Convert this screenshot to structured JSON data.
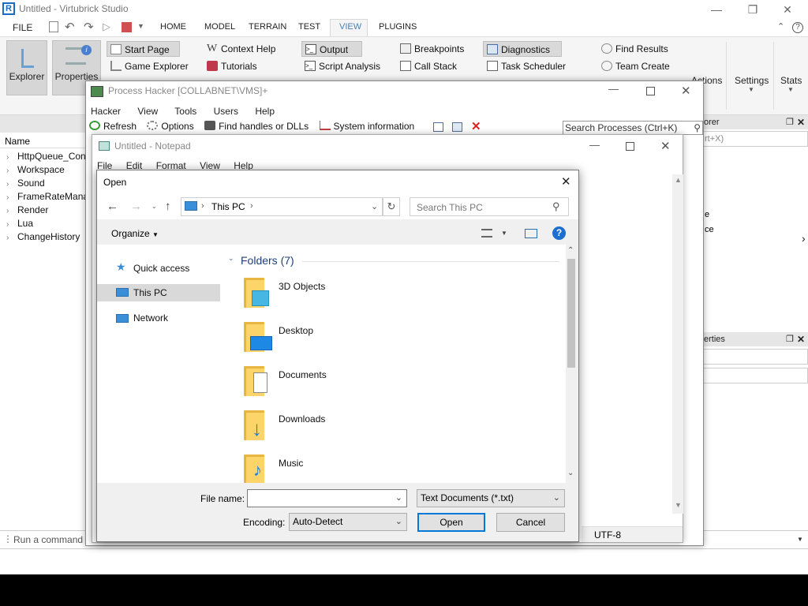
{
  "studio": {
    "title": "Untitled - Virtubrick Studio",
    "logo_letter": "R",
    "menu": {
      "file": "FILE"
    },
    "tabs": [
      "HOME",
      "MODEL",
      "TERRAIN",
      "TEST",
      "VIEW",
      "PLUGINS"
    ],
    "active_tab": "VIEW",
    "ribbon": {
      "explorer": "Explorer",
      "properties": "Properties",
      "col1": [
        "Start Page",
        "Game Explorer"
      ],
      "col2": [
        "Context Help",
        "Tutorials"
      ],
      "col3": [
        "Output",
        "Script Analysis"
      ],
      "col4": [
        "Breakpoints",
        "Call Stack"
      ],
      "col5": [
        "Diagnostics",
        "Task Scheduler"
      ],
      "col6": [
        "Find Results",
        "Team Create"
      ],
      "actions": "Actions",
      "settings": "Settings",
      "stats": "Stats"
    },
    "explorer_column": "Name",
    "tree": [
      "HttpQueue_Con",
      "Workspace",
      "Sound",
      "FrameRateMana",
      "Render",
      "Lua",
      "ChangeHistory"
    ],
    "right_panel": {
      "explorer_header": "orer",
      "filter_hint": "rt+X)",
      "frag1": "e",
      "frag2": "ce",
      "properties_header": "erties"
    },
    "command_placeholder": "Run a command"
  },
  "process_hacker": {
    "title": "Process Hacker [COLLABNET\\VMS]+",
    "menu": [
      "Hacker",
      "View",
      "Tools",
      "Users",
      "Help"
    ],
    "toolbar": [
      "Refresh",
      "Options",
      "Find handles or DLLs",
      "System information"
    ],
    "search_placeholder": "Search Processes (Ctrl+K)"
  },
  "notepad": {
    "title": "Untitled - Notepad",
    "menu": [
      "File",
      "Edit",
      "Format",
      "View",
      "Help"
    ],
    "encoding_status": "UTF-8"
  },
  "open_dialog": {
    "title": "Open",
    "address": "This PC",
    "search_placeholder": "Search This PC",
    "organize": "Organize",
    "nav": [
      "Quick access",
      "This PC",
      "Network"
    ],
    "selected_nav": "This PC",
    "group_header": "Folders (7)",
    "folders": [
      "3D Objects",
      "Desktop",
      "Documents",
      "Downloads",
      "Music"
    ],
    "file_name_label": "File name:",
    "file_name_value": "",
    "file_type": "Text Documents (*.txt)",
    "encoding_label": "Encoding:",
    "encoding_value": "Auto-Detect",
    "open_button": "Open",
    "cancel_button": "Cancel"
  },
  "colors": {
    "accent": "#0078d7",
    "folder_yellow": "#fcd46a",
    "selection": "#d9d9d9"
  }
}
